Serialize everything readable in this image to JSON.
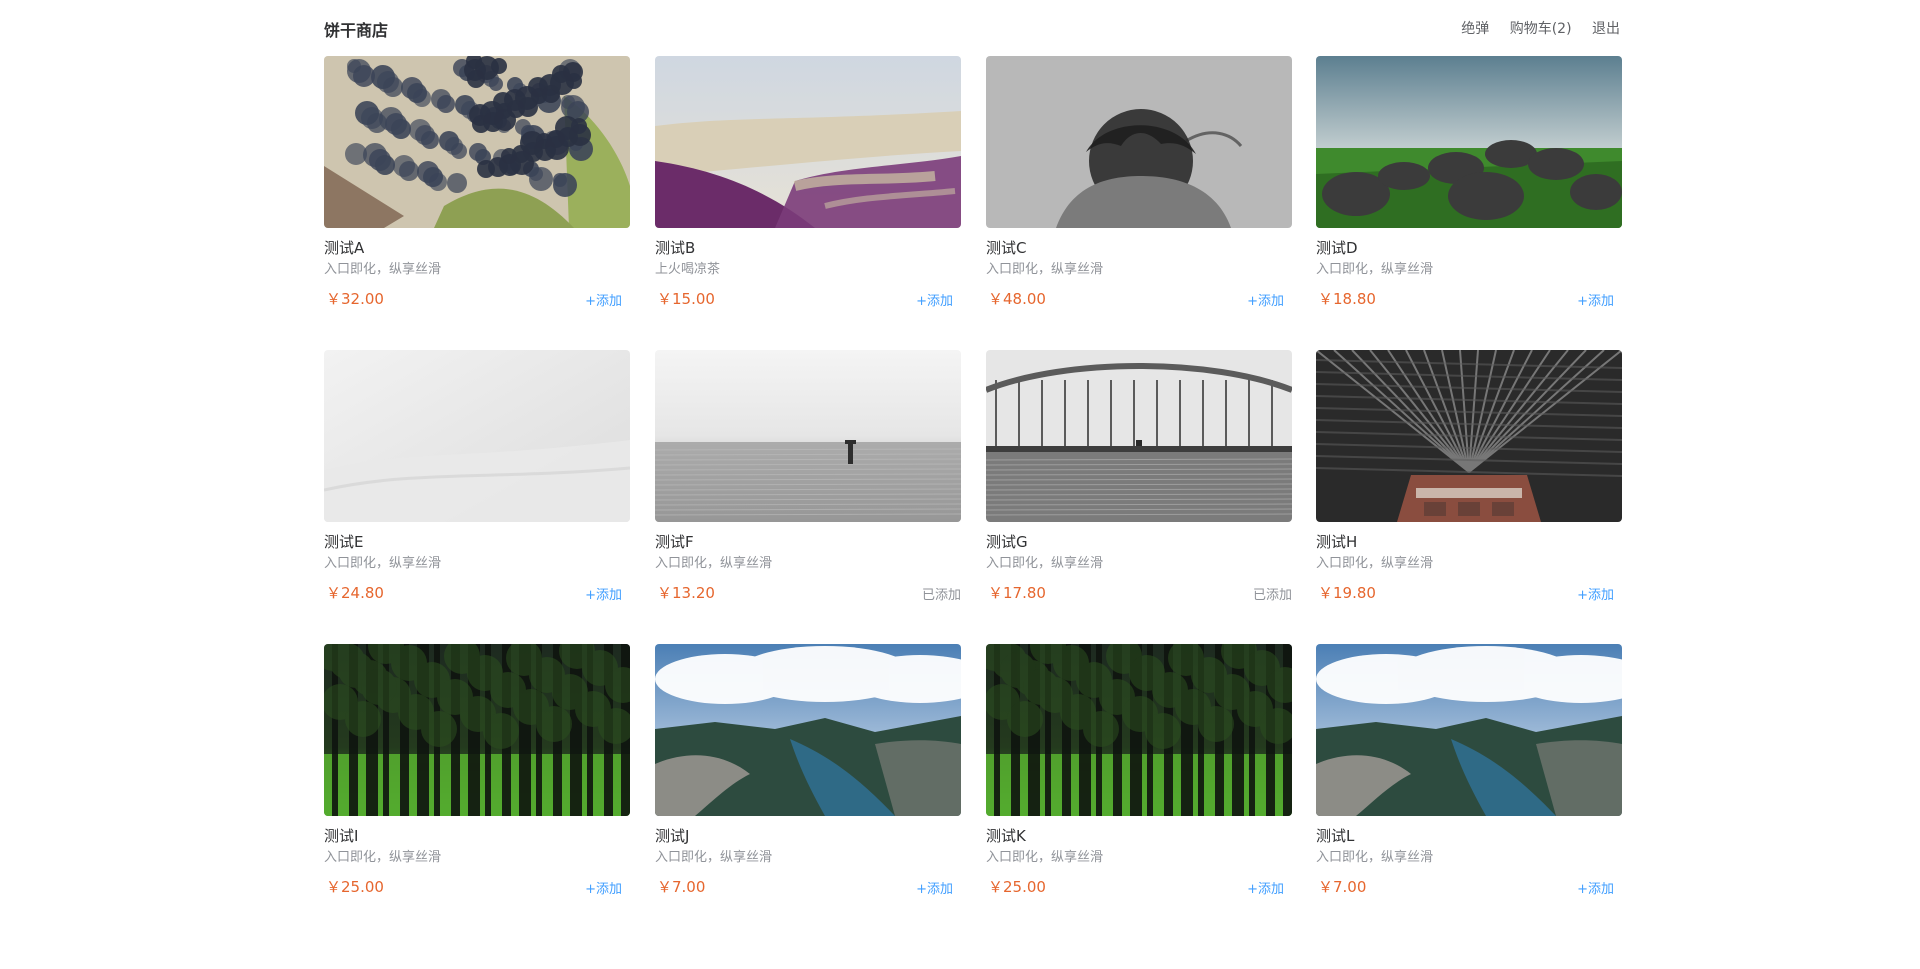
{
  "header": {
    "brand": "饼干商店",
    "nav": [
      "绝弹",
      "购物车(2)",
      "退出"
    ]
  },
  "products": [
    {
      "name": "测试A",
      "desc": "入口即化，纵享丝滑",
      "price": "￥32.00",
      "action": "+添加",
      "image": "grapes"
    },
    {
      "name": "测试B",
      "desc": "上火喝凉茶",
      "price": "￥15.00",
      "action": "+添加",
      "image": "beach-purple"
    },
    {
      "name": "测试C",
      "desc": "入口即化，纵享丝滑",
      "price": "￥48.00",
      "action": "+添加",
      "image": "woman-gray"
    },
    {
      "name": "测试D",
      "desc": "入口即化，纵享丝滑",
      "price": "￥18.80",
      "action": "+添加",
      "image": "boulders-field"
    },
    {
      "name": "测试E",
      "desc": "入口即化，纵享丝滑",
      "price": "￥24.80",
      "action": "+添加",
      "image": "white-snow"
    },
    {
      "name": "测试F",
      "desc": "入口即化，纵享丝滑",
      "price": "￥13.20",
      "action": "已添加",
      "image": "sea-gray"
    },
    {
      "name": "测试G",
      "desc": "入口即化，纵享丝滑",
      "price": "￥17.80",
      "action": "已添加",
      "image": "bridge"
    },
    {
      "name": "测试H",
      "desc": "入口即化，纵享丝滑",
      "price": "￥19.80",
      "action": "+添加",
      "image": "station-roof"
    },
    {
      "name": "测试I",
      "desc": "入口即化，纵享丝滑",
      "price": "￥25.00",
      "action": "+添加",
      "image": "forest"
    },
    {
      "name": "测试J",
      "desc": "入口即化，纵享丝滑",
      "price": "￥7.00",
      "action": "+添加",
      "image": "fjord"
    },
    {
      "name": "测试K",
      "desc": "入口即化，纵享丝滑",
      "price": "￥25.00",
      "action": "+添加",
      "image": "forest"
    },
    {
      "name": "测试L",
      "desc": "入口即化，纵享丝滑",
      "price": "￥7.00",
      "action": "+添加",
      "image": "fjord"
    }
  ]
}
